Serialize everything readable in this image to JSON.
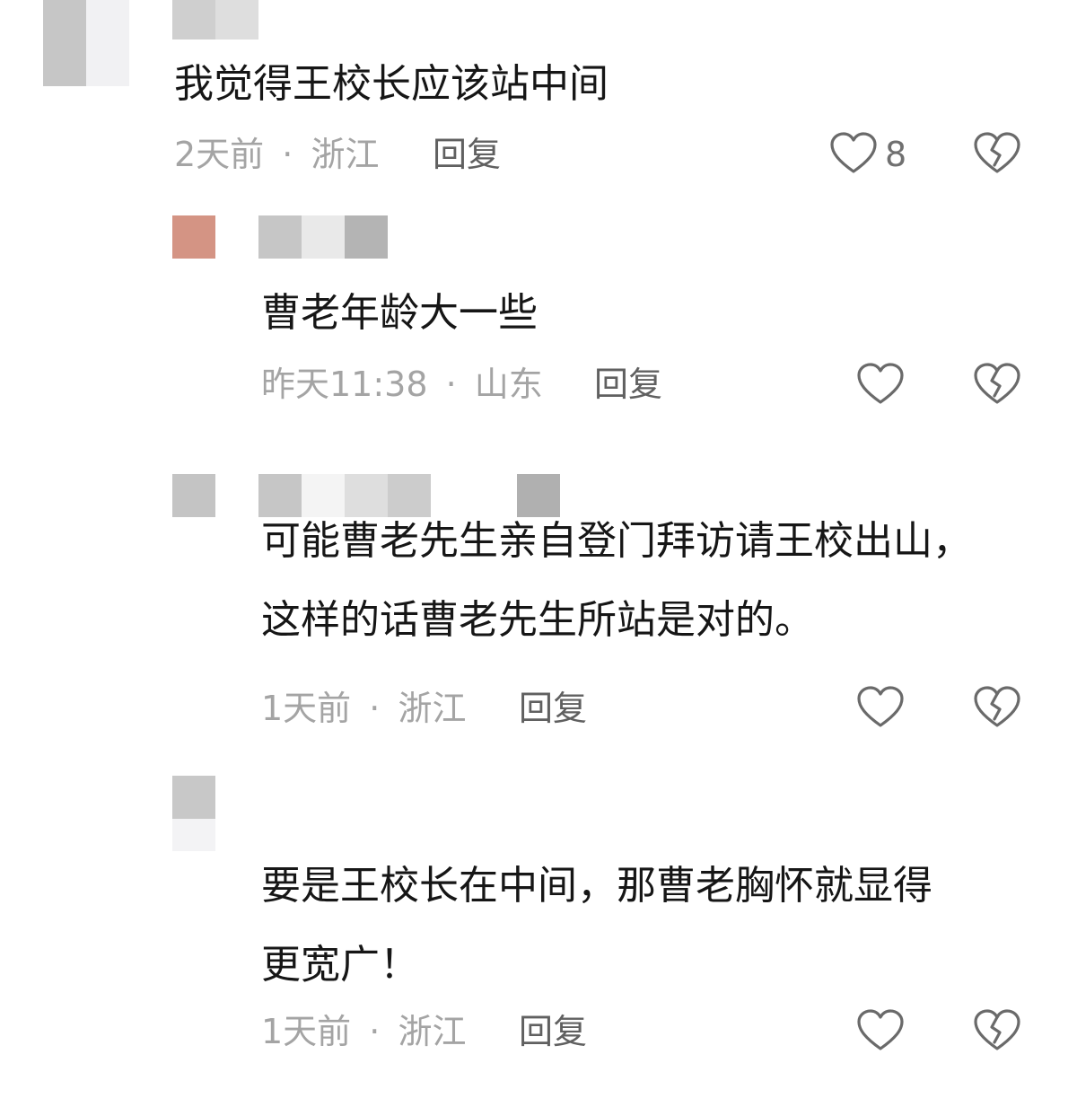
{
  "comments": [
    {
      "text_lines": [
        "我觉得王校长应该站中间"
      ],
      "time": "2天前",
      "separator": "·",
      "location": "浙江",
      "reply_label": "回复",
      "like_count": "8",
      "like_icon": "heart-outline-icon",
      "dislike_icon": "broken-heart-icon"
    },
    {
      "text_lines": [
        "曹老年龄大一些"
      ],
      "time": "昨天11:38",
      "separator": "·",
      "location": "山东",
      "reply_label": "回复",
      "like_icon": "heart-outline-icon",
      "dislike_icon": "broken-heart-icon"
    },
    {
      "text_lines": [
        "可能曹老先生亲自登门拜访请王校出山，",
        "这样的话曹老先生所站是对的。"
      ],
      "time": "1天前",
      "separator": "·",
      "location": "浙江",
      "reply_label": "回复",
      "like_icon": "heart-outline-icon",
      "dislike_icon": "broken-heart-icon"
    },
    {
      "text_lines": [
        "要是王校长在中间，那曹老胸怀就显得",
        "更宽广！"
      ],
      "time": "1天前",
      "separator": "·",
      "location": "浙江",
      "reply_label": "回复",
      "like_icon": "heart-outline-icon",
      "dislike_icon": "broken-heart-icon"
    }
  ],
  "colors": {
    "text": "#161616",
    "meta": "#a4a4a4",
    "reply": "#606060",
    "icon": "#6a6a6a",
    "avatar_reply": "#d49484",
    "pixelation_gray": "#c4c4c4"
  }
}
